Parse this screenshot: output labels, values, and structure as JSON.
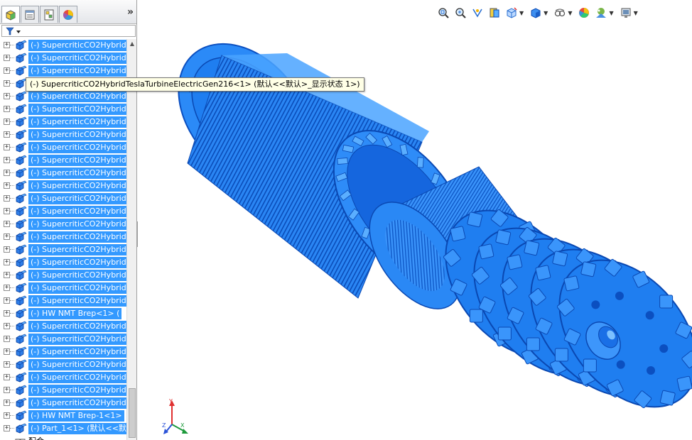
{
  "panel": {
    "tabs": [
      {
        "name": "feature-manager-tab-icon",
        "active": true
      },
      {
        "name": "property-manager-tab-icon",
        "active": false
      },
      {
        "name": "configuration-manager-tab-icon",
        "active": false
      },
      {
        "name": "display-manager-tab-icon",
        "active": false
      }
    ],
    "more_label": "»",
    "filter_icon": "filter-icon"
  },
  "tree": {
    "rows": [
      {
        "label": "(-) SupercriticCO2Hybrid"
      },
      {
        "label": "(-) SupercriticCO2Hybrid"
      },
      {
        "label": "(-) SupercriticCO2Hybrid"
      },
      {
        "label": "(-) SupercriticCO2Hybrid"
      },
      {
        "label": "(-) SupercriticCO2Hybrid"
      },
      {
        "label": "(-) SupercriticCO2Hybrid"
      },
      {
        "label": "(-) SupercriticCO2Hybrid"
      },
      {
        "label": "(-) SupercriticCO2Hybrid"
      },
      {
        "label": "(-) SupercriticCO2Hybrid"
      },
      {
        "label": "(-) SupercriticCO2Hybrid"
      },
      {
        "label": "(-) SupercriticCO2Hybrid"
      },
      {
        "label": "(-) SupercriticCO2Hybrid"
      },
      {
        "label": "(-) SupercriticCO2Hybrid"
      },
      {
        "label": "(-) SupercriticCO2Hybrid"
      },
      {
        "label": "(-) SupercriticCO2Hybrid"
      },
      {
        "label": "(-) SupercriticCO2Hybrid"
      },
      {
        "label": "(-) SupercriticCO2Hybrid"
      },
      {
        "label": "(-) SupercriticCO2Hybrid"
      },
      {
        "label": "(-) SupercriticCO2Hybrid"
      },
      {
        "label": "(-) SupercriticCO2Hybrid"
      },
      {
        "label": "(-) SupercriticCO2Hybrid"
      },
      {
        "label": "(-) HW NMT Brep<1> ("
      },
      {
        "label": "(-) SupercriticCO2Hybrid"
      },
      {
        "label": "(-) SupercriticCO2Hybrid"
      },
      {
        "label": "(-) SupercriticCO2Hybrid"
      },
      {
        "label": "(-) SupercriticCO2Hybrid"
      },
      {
        "label": "(-) SupercriticCO2Hybrid"
      },
      {
        "label": "(-) SupercriticCO2Hybrid"
      },
      {
        "label": "(-) SupercriticCO2Hybrid"
      },
      {
        "label": "(-) HW NMT Brep-1<1>"
      },
      {
        "label": "(-) Part_1<1> (默认<<默"
      }
    ],
    "last_partial_label": "配合"
  },
  "tooltip": {
    "text": "(-) SupercriticCO2HybridTeslaTurbineElectricGen216<1> (默认<<默认>_显示状态 1>)"
  },
  "view_toolbar": {
    "buttons": [
      {
        "name": "zoom-to-fit-icon",
        "dropdown": false
      },
      {
        "name": "zoom-to-area-icon",
        "dropdown": false
      },
      {
        "name": "previous-view-icon",
        "dropdown": false
      },
      {
        "name": "section-view-icon",
        "dropdown": false
      },
      {
        "name": "view-orientation-icon",
        "dropdown": true
      },
      {
        "name": "display-style-icon",
        "dropdown": true
      },
      {
        "name": "hide-show-items-icon",
        "dropdown": true
      },
      {
        "name": "edit-appearance-icon",
        "dropdown": false
      },
      {
        "name": "apply-scene-icon",
        "dropdown": true
      },
      {
        "name": "view-settings-icon",
        "dropdown": true
      }
    ]
  },
  "colors": {
    "selection": "#3399ff",
    "model_blue": "#1e7ff2",
    "model_dark": "#0b4fc0",
    "model_light": "#5aaeff"
  },
  "triad": {
    "x": "X",
    "y": "Y",
    "z": "Z"
  }
}
